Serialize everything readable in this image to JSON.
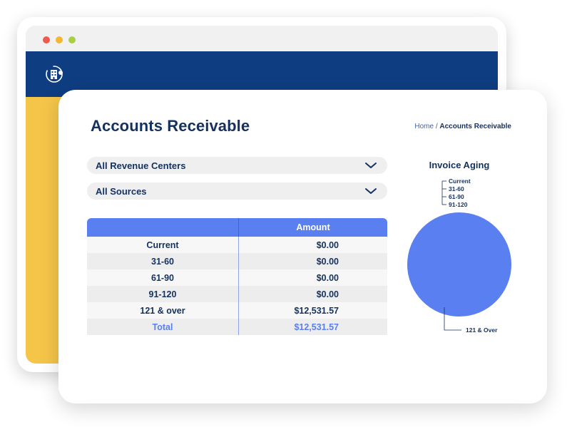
{
  "header": {
    "logo_icon": "building-globe-icon",
    "brand_color": "#0F3D82"
  },
  "page": {
    "title": "Accounts Receivable",
    "breadcrumb": {
      "home": "Home",
      "separator": " / ",
      "current": "Accounts Receivable"
    }
  },
  "filters": {
    "revenue_centers": {
      "value": "All Revenue Centers",
      "icon": "chevron-down-icon"
    },
    "sources": {
      "value": "All Sources",
      "icon": "chevron-down-icon"
    }
  },
  "table": {
    "columns": [
      "",
      "Amount"
    ],
    "rows": [
      {
        "label": "Current",
        "amount": "$0.00"
      },
      {
        "label": "31-60",
        "amount": "$0.00"
      },
      {
        "label": "61-90",
        "amount": "$0.00"
      },
      {
        "label": "91-120",
        "amount": "$0.00"
      },
      {
        "label": "121 & over",
        "amount": "$12,531.57"
      }
    ],
    "total": {
      "label": "Total",
      "amount": "$12,531.57"
    }
  },
  "chart_data": {
    "type": "pie",
    "title": "Invoice Aging",
    "categories": [
      "Current",
      "31-60",
      "61-90",
      "91-120",
      "121 & Over"
    ],
    "values": [
      0,
      0,
      0,
      0,
      12531.57
    ],
    "colors": [
      "#5A7FF0",
      "#5A7FF0",
      "#5A7FF0",
      "#5A7FF0",
      "#5A7FF0"
    ]
  }
}
